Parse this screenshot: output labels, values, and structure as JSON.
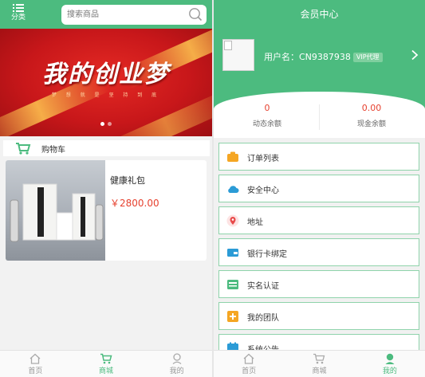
{
  "shop": {
    "menu_label": "分类",
    "search_placeholder": "搜索商品",
    "banner_title": "我的创业梦",
    "banner_subtitle": "梦 想 就 是 坚 持 到 底",
    "cart_label": "购物车",
    "product": {
      "name": "健康礼包",
      "price": "￥2800.00"
    },
    "tabs": [
      {
        "label": "首页",
        "icon": "home-icon",
        "active": false
      },
      {
        "label": "商城",
        "icon": "cart-icon",
        "active": true
      },
      {
        "label": "我的",
        "icon": "user-icon",
        "active": false
      }
    ]
  },
  "member": {
    "title": "会员中心",
    "username": "用户名：CN9387938",
    "vip_badge": "VIP代理",
    "dynamic_balance": {
      "value": "0",
      "label": "动态余额"
    },
    "cash_balance": {
      "value": "0.00",
      "label": "现金余额"
    },
    "menu": [
      {
        "label": "订单列表",
        "icon": "order-list-icon",
        "color": "#f5a623"
      },
      {
        "label": "安全中心",
        "icon": "cloud-security-icon",
        "color": "#2b9bd6"
      },
      {
        "label": "地址",
        "icon": "location-pin-icon",
        "color": "#e84a4a"
      },
      {
        "label": "银行卡绑定",
        "icon": "bank-card-icon",
        "color": "#2b9bd6"
      },
      {
        "label": "实名认证",
        "icon": "id-verify-icon",
        "color": "#4cbb7f"
      },
      {
        "label": "我的团队",
        "icon": "team-plus-icon",
        "color": "#f5a623"
      },
      {
        "label": "系统公告",
        "icon": "announcement-icon",
        "color": "#2b9bd6"
      }
    ],
    "tabs": [
      {
        "label": "首页",
        "icon": "home-icon",
        "active": false
      },
      {
        "label": "商城",
        "icon": "cart-icon",
        "active": false
      },
      {
        "label": "我的",
        "icon": "user-icon",
        "active": true
      }
    ]
  },
  "colors": {
    "brand_green": "#4cbb7f",
    "price_red": "#e6412f",
    "border_green": "#8fd3ab"
  }
}
